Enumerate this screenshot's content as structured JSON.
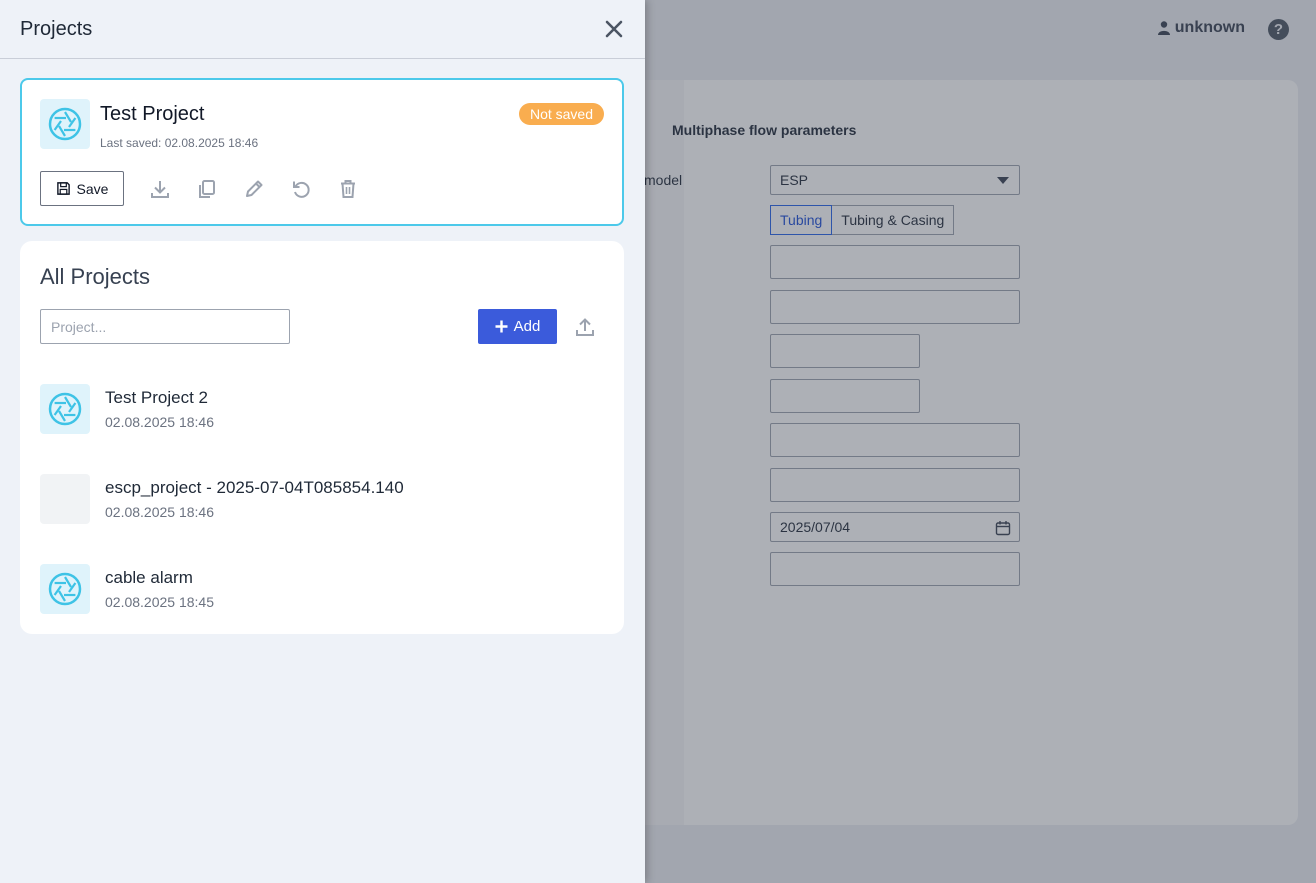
{
  "background": {
    "user": "unknown",
    "help": "?",
    "section_title": "Multiphase flow parameters",
    "model_label": "model",
    "model_value": "ESP",
    "toggle": [
      "Tubing",
      "Tubing & Casing"
    ],
    "date_value": "2025/07/04"
  },
  "drawer": {
    "title": "Projects",
    "current": {
      "name": "Test Project",
      "last_saved": "Last saved: 02.08.2025 18:46",
      "status": "Not saved",
      "save_label": "Save"
    },
    "all": {
      "title": "All Projects",
      "search_placeholder": "Project...",
      "add_label": "Add",
      "items": [
        {
          "name": "Test Project 2",
          "date": "02.08.2025 18:46",
          "logo": "project-logo"
        },
        {
          "name": "escp_project - 2025-07-04T085854.140",
          "date": "02.08.2025 18:46",
          "logo": "blank"
        },
        {
          "name": "cable alarm",
          "date": "02.08.2025 18:45",
          "logo": "project-logo"
        }
      ]
    }
  },
  "colors": {
    "accent_border": "#4cc9ea",
    "badge": "#f9ad4f",
    "add_button": "#3b5bdb",
    "drawer_bg": "#eef2f8"
  }
}
